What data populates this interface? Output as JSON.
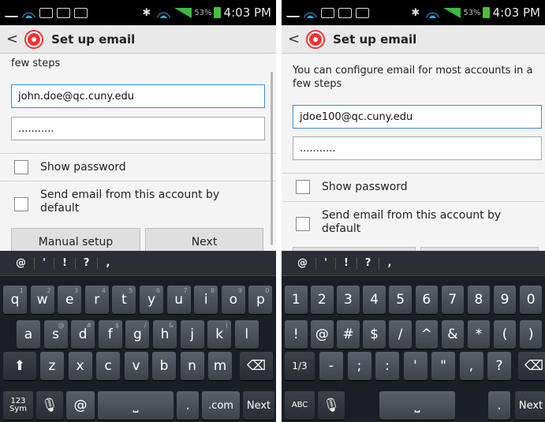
{
  "status": {
    "battery": "53%",
    "time": "4:03 PM"
  },
  "app": {
    "title": "Set up email",
    "back": "<"
  },
  "left": {
    "instruction_partial": "few steps",
    "email": "john.doe@qc.cuny.edu",
    "password": "...........",
    "show_password": "Show password",
    "send_default": "Send email from this account by default",
    "manual": "Manual setup",
    "next": "Next"
  },
  "right": {
    "instruction": "You can configure email for most accounts in a few steps",
    "email": "jdoe100@qc.cuny.edu",
    "password": "...........",
    "show_password": "Show password",
    "send_default": "Send email from this account by default"
  },
  "keyboard_left": {
    "suggestions": [
      "@",
      "'",
      "!",
      "?",
      ","
    ],
    "row1": [
      "q",
      "w",
      "e",
      "r",
      "t",
      "y",
      "u",
      "i",
      "o",
      "p"
    ],
    "row1_hints": [
      "1",
      "2",
      "3",
      "4",
      "5",
      "6",
      "7",
      "8",
      "9",
      "0"
    ],
    "row2": [
      "a",
      "s",
      "d",
      "f",
      "g",
      "h",
      "j",
      "k",
      "l"
    ],
    "row2_hints": [
      "",
      "@",
      "#",
      "$",
      "/",
      "&",
      "",
      "(",
      ""
    ],
    "row3": [
      "z",
      "x",
      "c",
      "v",
      "b",
      "n",
      "m"
    ],
    "shift": "⬆",
    "del": "⌫",
    "sym": "123 Sym",
    "mic": "🎙",
    "at": "@",
    "space": "⎵",
    "dot": ".",
    "com": ".com",
    "next": "Next"
  },
  "keyboard_right": {
    "suggestions": [
      "@",
      "'",
      "!",
      "?",
      ","
    ],
    "row1": [
      "1",
      "2",
      "3",
      "4",
      "5",
      "6",
      "7",
      "8",
      "9",
      "0"
    ],
    "row2": [
      "!",
      "@",
      "#",
      "$",
      "/",
      "^",
      "&",
      "*",
      "(",
      ")"
    ],
    "row3_page": "1/3",
    "row3": [
      "-",
      ";",
      ":",
      "'",
      "\"",
      ",",
      "?"
    ],
    "del": "⌫",
    "abc": "ABC",
    "mic": "🎙",
    "space": "⎵",
    "dot": ".",
    "next": "Next"
  }
}
